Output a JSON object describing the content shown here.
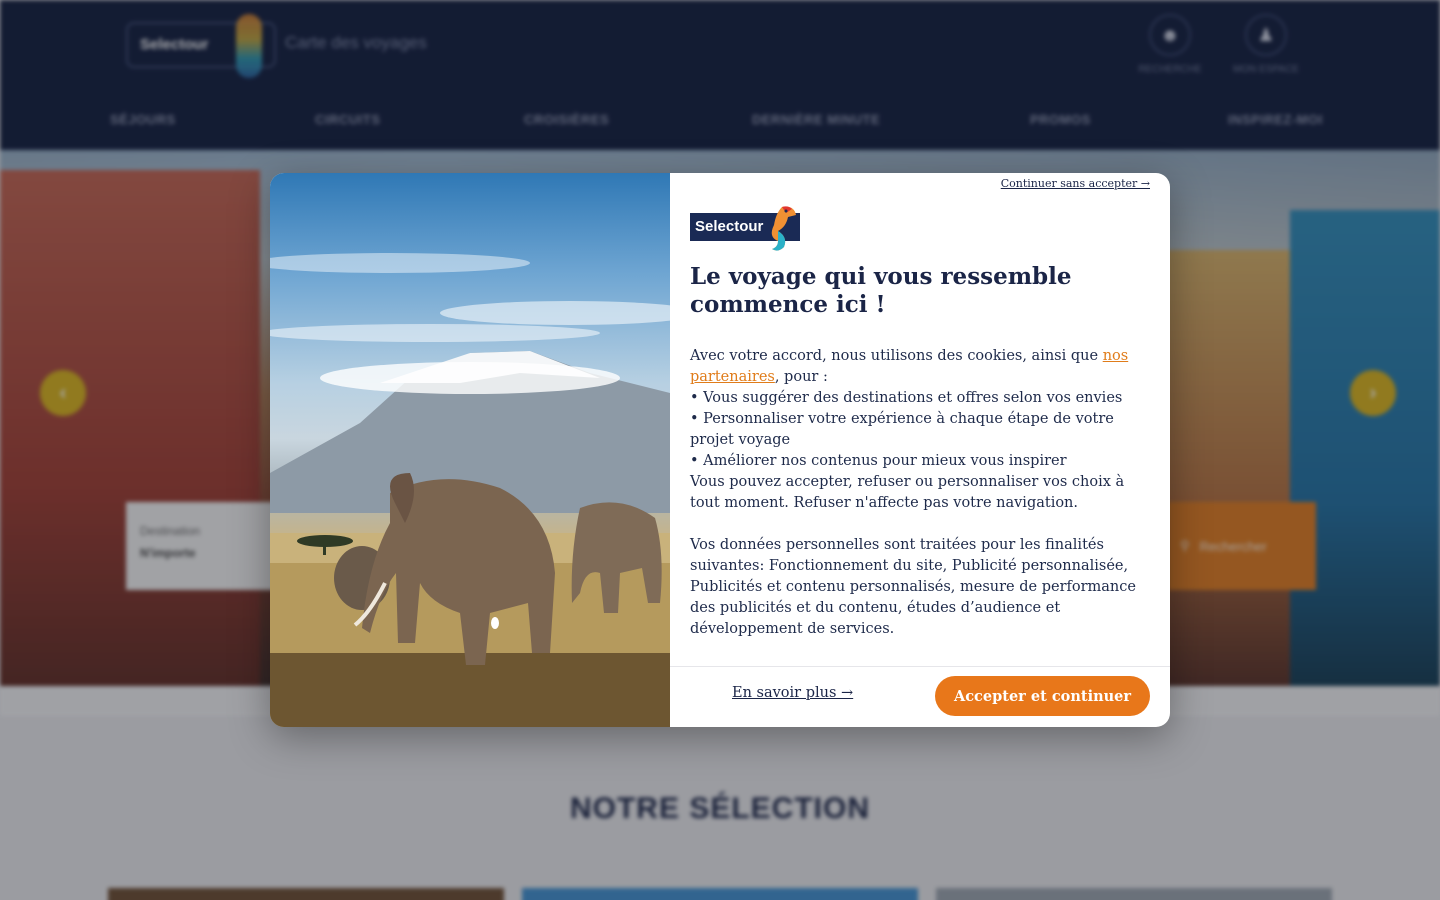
{
  "site": {
    "logo_text": "Selectour",
    "tagline": "Carte des voyages",
    "header_actions": [
      {
        "label": "RECHERCHE",
        "icon": "user-icon"
      },
      {
        "label": "MON ESPACE",
        "icon": "account-icon"
      }
    ],
    "nav": [
      "SÉJOURS",
      "CIRCUITS",
      "CROISIÈRES",
      "DERNIÈRE MINUTE",
      "PROMOS",
      "INSPIREZ-MOI"
    ],
    "hero": {
      "field_label": "Destination",
      "field_value": "N'importe",
      "search_label": "Rechercher"
    },
    "section_title": "NOTRE SÉLECTION"
  },
  "modal": {
    "skip_link": "Continuer sans accepter →",
    "logo_text": "Selectour",
    "title": "Le voyage qui vous ressemble commence ici !",
    "intro_before": "Avec votre accord, nous utilisons des cookies, ainsi que ",
    "partners_link": "nos partenaires",
    "intro_after": ", pour :",
    "bullets": [
      "• Vous suggérer des destinations et offres selon vos envies",
      "• Personnaliser votre expérience à chaque étape de votre projet voyage",
      "• Améliorer nos contenus pour mieux vous inspirer"
    ],
    "choice_text": "Vous pouvez accepter, refuser ou personnaliser vos choix à tout moment. Refuser n'affecte pas votre navigation.",
    "purposes_text": "Vos données personnelles sont traitées pour les finalités suivantes: Fonctionnement du site, Publicité personnalisée, Publicités et contenu personnalisés, mesure de performance des publicités et du contenu, études d’audience et développement de services.",
    "learn_more": "En savoir plus →",
    "accept": "Accepter et continuer"
  },
  "colors": {
    "navy": "#0e1a3b",
    "accent_orange": "#e8771a",
    "text_dark": "#1b2547"
  }
}
